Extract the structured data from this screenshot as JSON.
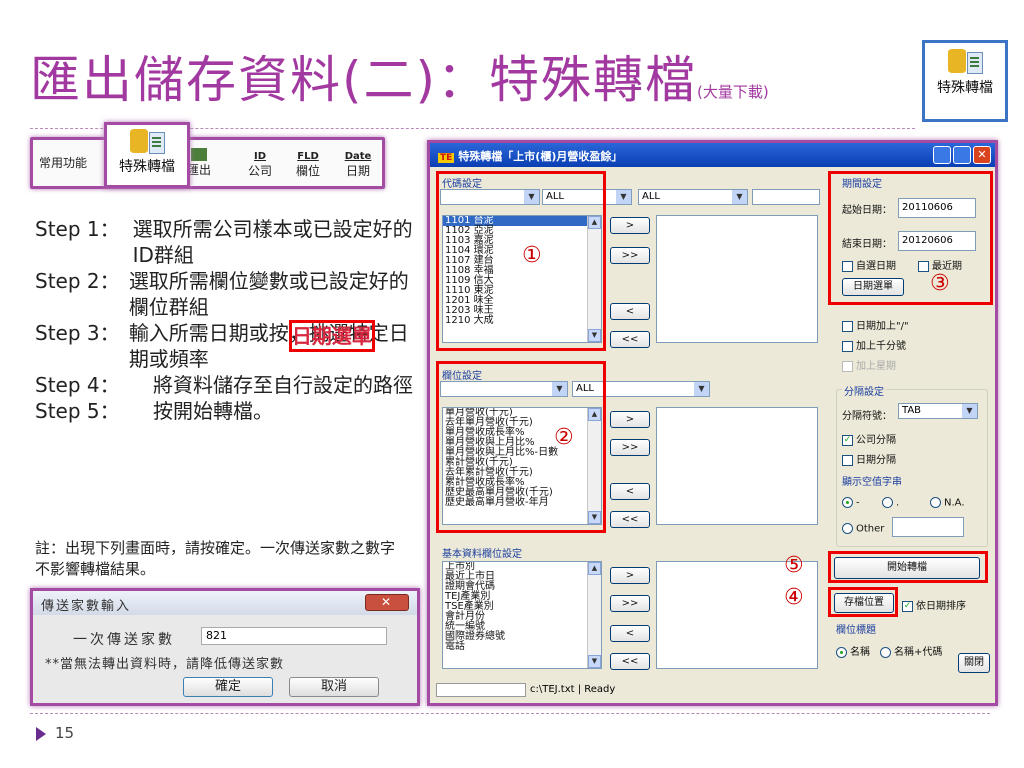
{
  "title": {
    "main": "匯出儲存資料(二)：特殊轉檔",
    "sub": "(大量下載)"
  },
  "top_icon": {
    "label": "特殊轉檔"
  },
  "toolbar": {
    "common": "常用功能",
    "special": "特殊轉檔",
    "export": "匯出",
    "id_top": "ID",
    "id_label": "公司",
    "fld_top": "FLD",
    "fld_label": "欄位",
    "date_top": "Date",
    "date_label": "日期"
  },
  "steps": [
    {
      "k": "Step 1：",
      "t1": "選取所需公司樣本或已設定好的ID群組",
      "r": "",
      "t2": ""
    },
    {
      "k": "Step 2：",
      "t1": "選取所需欄位變數或已設定好的欄位群組",
      "r": "",
      "t2": ""
    },
    {
      "k": "Step 3：",
      "t1": "輸入所需日期或按",
      "r": "日期選單",
      "t2": "，挑選特定日期或頻率"
    },
    {
      "k": "Step 4：",
      "t1": "將資料儲存至自行設定的路徑",
      "r": "",
      "t2": ""
    },
    {
      "k": "Step 5：",
      "t1": "按開始轉檔。",
      "r": "",
      "t2": ""
    }
  ],
  "note": "註：出現下列畫面時，請按確定。一次傳送家數之數字不影響轉檔結果。",
  "dialog": {
    "title": "傳送家數輸入",
    "label": "一次傳送家數",
    "value": "821",
    "warn": "**當無法轉出資料時，請降低傳送家數",
    "ok": "確定",
    "cancel": "取消"
  },
  "page_number": "15",
  "window": {
    "title": "特殊轉檔「上市(櫃)月營收盈餘」",
    "code_group": "代碼設定",
    "code_combo2": "ALL",
    "code_combo3": "ALL",
    "code_list": [
      "1101 台泥",
      "1102 亞泥",
      "1103 嘉泥",
      "1104 環泥",
      "1107 建台",
      "1108 幸福",
      "1109 信大",
      "1110 東泥",
      "1201 味全",
      "1203 味王",
      "1210 大成"
    ],
    "field_group": "欄位設定",
    "field_combo2": "ALL",
    "field_list": [
      "單月營收(千元)",
      "去年單月營收(千元)",
      "單月營收成長率%",
      "單月營收與上月比%",
      "單月營收與上月比%-日數",
      "累計營收(千元)",
      "去年累計營收(千元)",
      "累計營收成長率%",
      "歷史最高單月營收(千元)",
      "歷史最高單月營收-年月"
    ],
    "basic_group": "基本資料欄位設定",
    "basic_list": [
      "上市別",
      "最近上市日",
      "證期會代碼",
      "TEJ產業別",
      "TSE產業別",
      "會計月份",
      "統一編號",
      "國際證券總號",
      "電話"
    ],
    "btn_add": ">",
    "btn_addall": ">>",
    "btn_remove": "<",
    "btn_removeall": "<<",
    "period_group": "期間設定",
    "start_label": "起始日期：",
    "start_value": "20110606",
    "end_label": "結束日期：",
    "end_value": "20120606",
    "opt_custom": "自選日期",
    "opt_recent": "最近期",
    "date_menu": "日期選單",
    "opt_slash": "日期加上\"/\"",
    "opt_thousand": "加上千分號",
    "opt_weekday": "加上星期",
    "sep_group": "分隔設定",
    "sep_label": "分隔符號：",
    "sep_value": "TAB",
    "opt_company_sep": "公司分隔",
    "opt_date_sep": "日期分隔",
    "empty_group": "顯示空值字串",
    "empty_dash": "-",
    "empty_dot": ".",
    "empty_na": "N.A.",
    "empty_other": "Other",
    "start_convert": "開始轉檔",
    "save_location": "存檔位置",
    "sort_by_date": "依日期排序",
    "header_group": "欄位標題",
    "header_name": "名稱",
    "header_name_code": "名稱+代碼",
    "close": "關閉",
    "status": "c:\\TEJ.txt | Ready",
    "markers": [
      "①",
      "②",
      "③",
      "④",
      "⑤"
    ]
  }
}
